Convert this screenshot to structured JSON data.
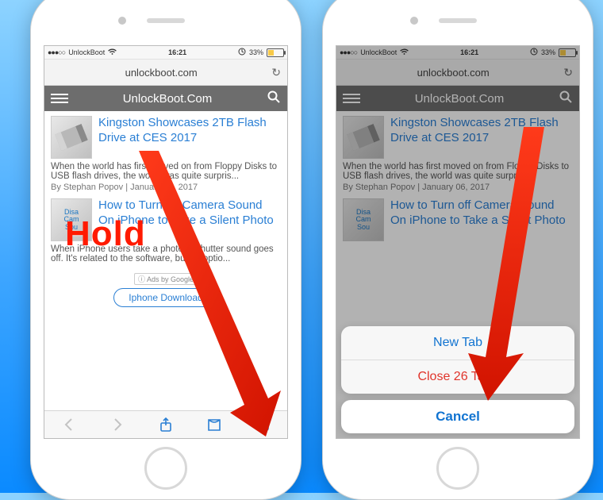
{
  "annotation": {
    "hold_label": "Hold"
  },
  "status_bar": {
    "carrier": "UnlockBoot",
    "time": "16:21",
    "battery_percent": "33%"
  },
  "browser": {
    "url": "unlockboot.com",
    "site_title": "UnlockBoot.Com"
  },
  "posts": [
    {
      "title": "Kingston Showcases 2TB Flash Drive at CES 2017",
      "excerpt_full": "When the world has first moved on from Floppy Disks to USB flash drives, the world was quite surpris...",
      "excerpt_short": "When the world has first moved on from Floppy Disks to USB flash drives, the world was quite surpris...",
      "author": "Stephan Popov",
      "date": "January 06, 2017"
    },
    {
      "title": "How to Turn off Camera Sound On iPhone to Take a Silent Photo",
      "excerpt_full": "When iPhone users take a photo, a shutter sound goes off. It's related to the software, but no optio...",
      "author": "",
      "date": "",
      "thumb_text": "Disa\nCam\nSou"
    }
  ],
  "ad": {
    "label": "Ads by Google",
    "button": "Iphone Download"
  },
  "action_sheet": {
    "new_tab": "New Tab",
    "close_tabs": "Close 26 Tabs",
    "cancel": "Cancel"
  }
}
